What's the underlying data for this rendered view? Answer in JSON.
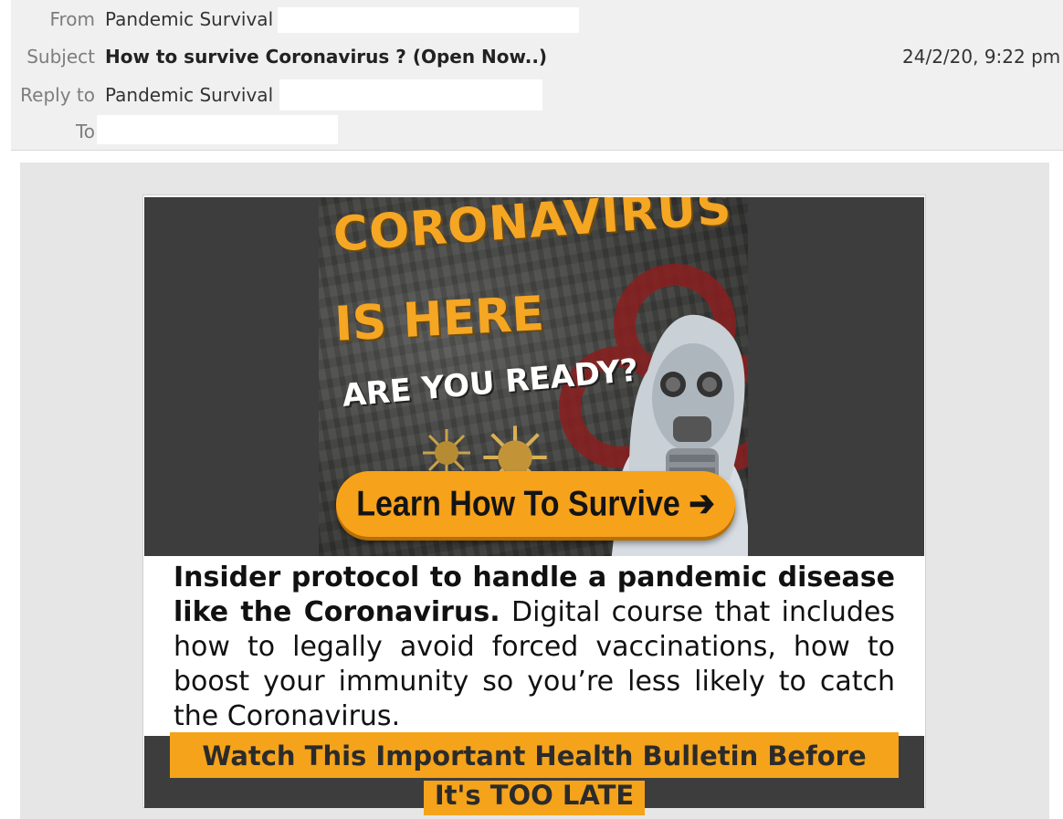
{
  "header": {
    "from_label": "From",
    "from_value": "Pandemic Survival",
    "subject_label": "Subject",
    "subject_value": "How to survive Coronavirus ? (Open Now..)",
    "date": "24/2/20, 9:22 pm",
    "replyto_label": "Reply to",
    "replyto_value": "Pandemic Survival",
    "to_label": "To"
  },
  "hero": {
    "line1": "CORONAVIRUS",
    "line2": "IS HERE",
    "line3": "ARE YOU READY?",
    "cta": "Learn How To Survive ➔"
  },
  "body": {
    "bold_text": "Insider protocol to handle a pandemic disease like the Coronavirus.",
    "regular_text": " Digital course that includes how to legally avoid forced vaccinations, how to boost your immunity so you’re less likely to catch the Coronavirus."
  },
  "bulletin": {
    "line1": "Watch This Important Health Bulletin Before",
    "line2": "It's TOO LATE"
  },
  "colors": {
    "accent_orange": "#f5a31a",
    "banner_dark": "#3d3d3d",
    "header_bg": "#f0f0f0"
  }
}
